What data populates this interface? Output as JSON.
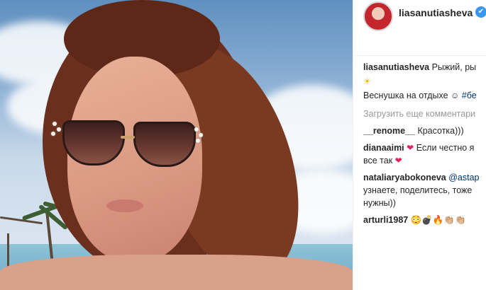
{
  "post": {
    "author": "liasanutiasheva",
    "caption_text": "Рыжий, ры",
    "caption_emoji": "☀",
    "caption_line2": "Веснушка на отдыхе",
    "caption_emoji2": "☺",
    "caption_tag": "#бе"
  },
  "load_more": "Загрузить еще комментари",
  "comments": [
    {
      "user": "__renome__",
      "text": "Красотка)))"
    },
    {
      "user": "dianaaimi",
      "text": "Если честно я",
      "text2": "все так"
    },
    {
      "user": "nataliaryabokoneva",
      "text": "@astap",
      "text2": "узнаете, поделитесь, тоже",
      "text3": "нужны))"
    },
    {
      "user": "arturli1987",
      "text": "😳💣🔥👏🏼👏🏼"
    }
  ],
  "heart_emoji": "❤",
  "verify_mark": "✔"
}
